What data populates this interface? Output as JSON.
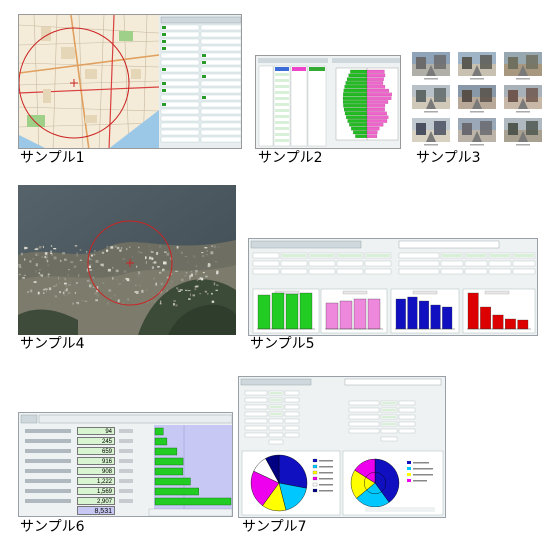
{
  "samples": [
    {
      "id": 1,
      "caption": "サンプル1",
      "kind": "map"
    },
    {
      "id": 2,
      "caption": "サンプル2",
      "kind": "population-pyramid"
    },
    {
      "id": 3,
      "caption": "サンプル3",
      "kind": "photo-grid"
    },
    {
      "id": 4,
      "caption": "サンプル4",
      "kind": "aerial-photo"
    },
    {
      "id": 5,
      "caption": "サンプル5",
      "kind": "bar-panels"
    },
    {
      "id": 6,
      "caption": "サンプル6",
      "kind": "income-distribution"
    },
    {
      "id": 7,
      "caption": "サンプル7",
      "kind": "pie-panels"
    }
  ],
  "sample6": {
    "values": [
      "94",
      "245",
      "659",
      "916",
      "908",
      "1,222",
      "1,569",
      "2,907"
    ],
    "total": "8,531"
  },
  "colors": {
    "green": "#22cc22",
    "pink": "#ee88dd",
    "blue": "#1010c0",
    "red": "#dd0000",
    "map_circle": "#cc2222",
    "panel_bg": "#e8eef0"
  }
}
